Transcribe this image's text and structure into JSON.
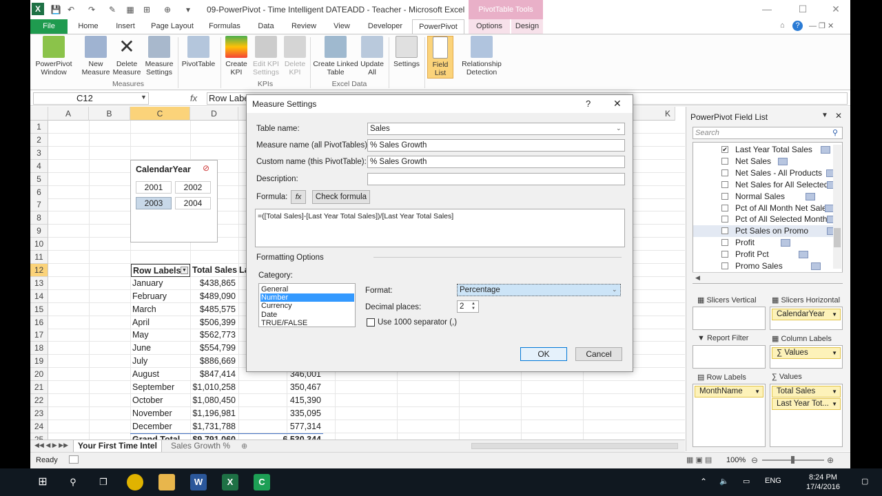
{
  "window": {
    "title": "09-PowerPivot - Time Intelligent DATEADD - Teacher - Microsoft Excel",
    "contextual_group": "PivotTable Tools"
  },
  "tabs": [
    {
      "label": "File"
    },
    {
      "label": "Home"
    },
    {
      "label": "Insert"
    },
    {
      "label": "Page Layout"
    },
    {
      "label": "Formulas"
    },
    {
      "label": "Data"
    },
    {
      "label": "Review"
    },
    {
      "label": "View"
    },
    {
      "label": "Developer"
    },
    {
      "label": "PowerPivot"
    },
    {
      "label": "Options"
    },
    {
      "label": "Design"
    }
  ],
  "ribbon": {
    "powerpivot_window": "PowerPivot Window",
    "new_measure": "New Measure",
    "delete_measure": "Delete Measure",
    "measure_settings": "Measure Settings",
    "pivottable": "PivotTable",
    "create_kpi": "Create KPI",
    "edit_kpi": "Edit KPI Settings",
    "delete_kpi": "Delete KPI",
    "create_linked": "Create Linked Table",
    "update_all": "Update All",
    "settings": "Settings",
    "field_list": "Field List",
    "relationship": "Relationship Detection",
    "group_measures": "Measures",
    "group_kpis": "KPIs",
    "group_excel_data": "Excel Data"
  },
  "formula_bar": {
    "name_box": "C12",
    "fx": "fx",
    "content": "Row Labels"
  },
  "grid": {
    "columns": [
      "A",
      "B",
      "C",
      "D",
      "K"
    ],
    "rows": [
      "1",
      "2",
      "3",
      "4",
      "5",
      "6",
      "7",
      "8",
      "9",
      "10",
      "11",
      "12",
      "13",
      "14",
      "15",
      "16",
      "17",
      "18",
      "19",
      "20",
      "21",
      "22",
      "23",
      "24",
      "25"
    ],
    "header_row": {
      "row_labels": "Row Labels",
      "total_sales": "Total Sales",
      "last_year_partial": "La"
    },
    "months": [
      {
        "month": "January",
        "sales": "$438,865",
        "last": ""
      },
      {
        "month": "February",
        "sales": "$489,090",
        "last": ""
      },
      {
        "month": "March",
        "sales": "$485,575",
        "last": ""
      },
      {
        "month": "April",
        "sales": "$506,399",
        "last": ""
      },
      {
        "month": "May",
        "sales": "$562,773",
        "last": ""
      },
      {
        "month": "June",
        "sales": "$554,799",
        "last": ""
      },
      {
        "month": "July",
        "sales": "$886,669",
        "last": ""
      },
      {
        "month": "August",
        "sales": "$847,414",
        "last": "346,001"
      },
      {
        "month": "September",
        "sales": "$1,010,258",
        "last": "350,467"
      },
      {
        "month": "October",
        "sales": "$1,080,450",
        "last": "415,390"
      },
      {
        "month": "November",
        "sales": "$1,196,981",
        "last": "335,095"
      },
      {
        "month": "December",
        "sales": "$1,731,788",
        "last": "577,314"
      }
    ],
    "grand_total": {
      "label": "Grand Total",
      "sales": "$9,791,060",
      "last": "6,530,344"
    }
  },
  "slicer": {
    "title": "CalendarYear",
    "years": [
      "2001",
      "2002",
      "2003",
      "2004"
    ]
  },
  "sheet_tabs": [
    "Your First Time Intel",
    "Sales Growth %"
  ],
  "status": {
    "ready": "Ready",
    "zoom": "100%"
  },
  "field_list": {
    "title": "PowerPivot Field List",
    "search_placeholder": "Search",
    "items": [
      {
        "label": "Last Year Total Sales",
        "checked": "✔"
      },
      {
        "label": "Net Sales",
        "checked": ""
      },
      {
        "label": "Net Sales - All Products",
        "checked": ""
      },
      {
        "label": "Net Sales for All Selected M",
        "checked": ""
      },
      {
        "label": "Normal Sales",
        "checked": ""
      },
      {
        "label": "Pct of All Month Net Sales",
        "checked": ""
      },
      {
        "label": "Pct of All Selected Months N",
        "checked": ""
      },
      {
        "label": "Pct Sales on Promo",
        "checked": ""
      },
      {
        "label": "Profit",
        "checked": ""
      },
      {
        "label": "Profit Pct",
        "checked": ""
      },
      {
        "label": "Promo Sales",
        "checked": ""
      }
    ],
    "slicers_vertical": "Slicers Vertical",
    "slicers_horizontal": "Slicers Horizontal",
    "slicers_horizontal_value": "CalendarYear",
    "report_filter": "Report Filter",
    "column_labels": "Column Labels",
    "column_labels_value": "∑ Values",
    "row_labels": "Row Labels",
    "row_labels_value": "MonthName",
    "values": "Values",
    "values_items": [
      "Total Sales",
      "Last Year Tot..."
    ]
  },
  "dialog": {
    "title": "Measure Settings",
    "help": "?",
    "table_name_label": "Table name:",
    "table_name": "Sales",
    "measure_name_label": "Measure name (all PivotTables):",
    "measure_name": "% Sales Growth",
    "custom_name_label": "Custom name (this PivotTable):",
    "custom_name": "% Sales Growth",
    "description_label": "Description:",
    "description": "",
    "formula_label": "Formula:",
    "fx_button": "fx",
    "check_formula": "Check formula",
    "formula": "=([Total Sales]-[Last Year Total Sales])/[Last Year Total Sales]",
    "formatting_options": "Formatting Options",
    "category_label": "Category:",
    "categories": [
      "General",
      "Number",
      "Currency",
      "Date",
      "TRUE/FALSE"
    ],
    "format_label": "Format:",
    "format_value": "Percentage",
    "decimal_label": "Decimal places:",
    "decimal_value": "2",
    "separator_label": "Use 1000 separator (,)",
    "ok": "OK",
    "cancel": "Cancel"
  },
  "taskbar": {
    "lang": "ENG",
    "time": "8:24 PM",
    "date": "17/4/2016"
  }
}
